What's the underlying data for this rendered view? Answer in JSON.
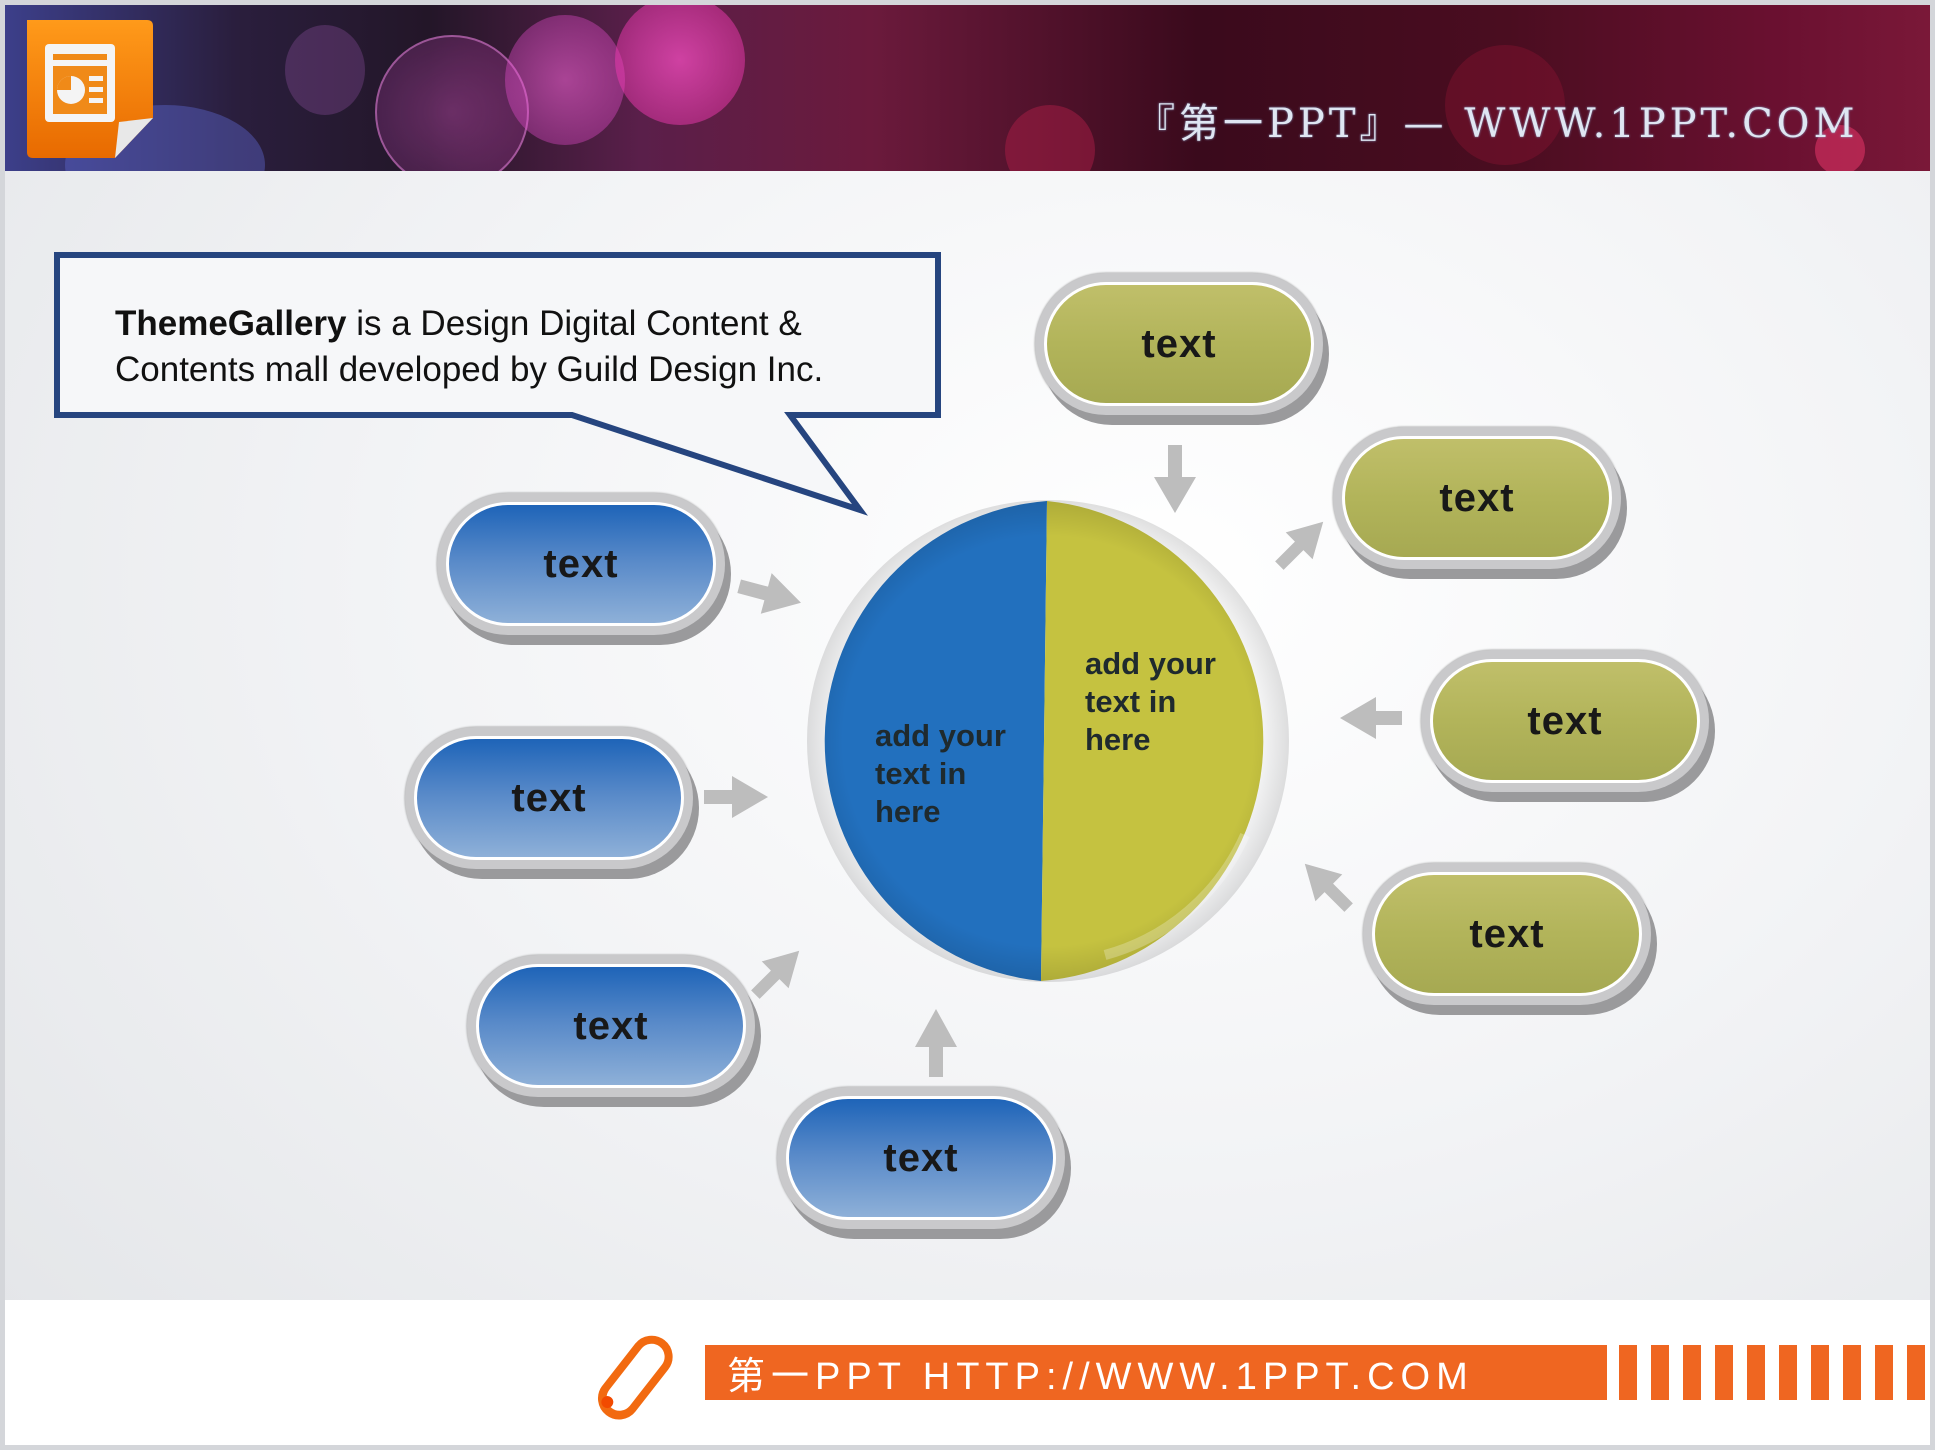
{
  "header": {
    "title": "『第一PPT』— WWW.1PPT.COM",
    "logo_icon": "powerpoint-document-icon"
  },
  "callout": {
    "bold": "ThemeGallery",
    "line1_rest": " is a Design Digital Content &",
    "line2": "Contents mall developed by Guild Design Inc."
  },
  "center_pie": {
    "left_label": "add your\ntext in\nhere",
    "right_label": "add your\ntext in\nhere",
    "colors": {
      "left": "#2270be",
      "right": "#c5c240"
    }
  },
  "blue_nodes": [
    {
      "label": "text"
    },
    {
      "label": "text"
    },
    {
      "label": "text"
    },
    {
      "label": "text"
    }
  ],
  "olive_nodes": [
    {
      "label": "text"
    },
    {
      "label": "text"
    },
    {
      "label": "text"
    },
    {
      "label": "text"
    }
  ],
  "arrow_icon": "gray-arrow-icon",
  "footer": {
    "text": "第一PPT HTTP://WWW.1PPT.COM",
    "accent_color": "#ef6621",
    "icon": "pencil-icon"
  }
}
